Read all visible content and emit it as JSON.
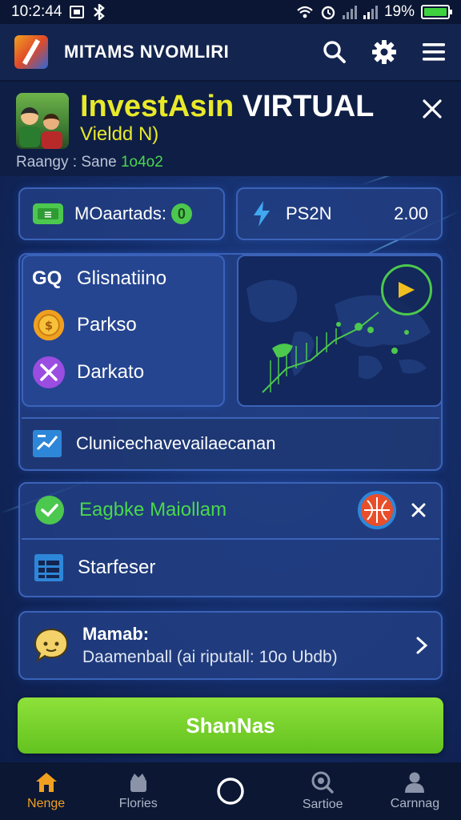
{
  "status_bar": {
    "time": "10:2:44",
    "battery": "19%"
  },
  "app_bar": {
    "title": "MITAMS NVOMLIRI"
  },
  "banner": {
    "title_highlight": "InvestAsin",
    "title_rest": " VIRTUAL",
    "subtitle": "Vieldd N)",
    "meta_label": "Raangy : Sane ",
    "meta_value": "1o4o2"
  },
  "tiles": [
    {
      "label": "MOaartads:",
      "badge": "0"
    },
    {
      "label": "PS2N",
      "value": "2.00"
    }
  ],
  "menu": [
    {
      "label": "Glisnatiino",
      "icon": "gq-icon"
    },
    {
      "label": "Parkso",
      "icon": "coin-badge-icon"
    },
    {
      "label": "Darkato",
      "icon": "crossed-tools-icon"
    }
  ],
  "wide_row": {
    "label": "Clunicechavevailaecanan"
  },
  "alert": {
    "label": "Eagbke Maiollam"
  },
  "section_row": {
    "label": "Starfeser"
  },
  "message": {
    "title": "Mamab:",
    "subtitle": "Daamenball (ai riputall: 10o Ubdb)"
  },
  "cta": {
    "label": "ShanNas"
  },
  "nav": [
    {
      "label": "Nenge",
      "icon": "home-icon"
    },
    {
      "label": "Flories",
      "icon": "crown-icon"
    },
    {
      "label": "",
      "icon": "circle-icon"
    },
    {
      "label": "Sartioe",
      "icon": "search-globe-icon"
    },
    {
      "label": "Carnnag",
      "icon": "profile-icon"
    }
  ],
  "colors": {
    "accent_green": "#63c21f",
    "highlight_yellow": "#e8e92a",
    "nav_active": "#f0a020",
    "bg_navy": "#142c66"
  }
}
